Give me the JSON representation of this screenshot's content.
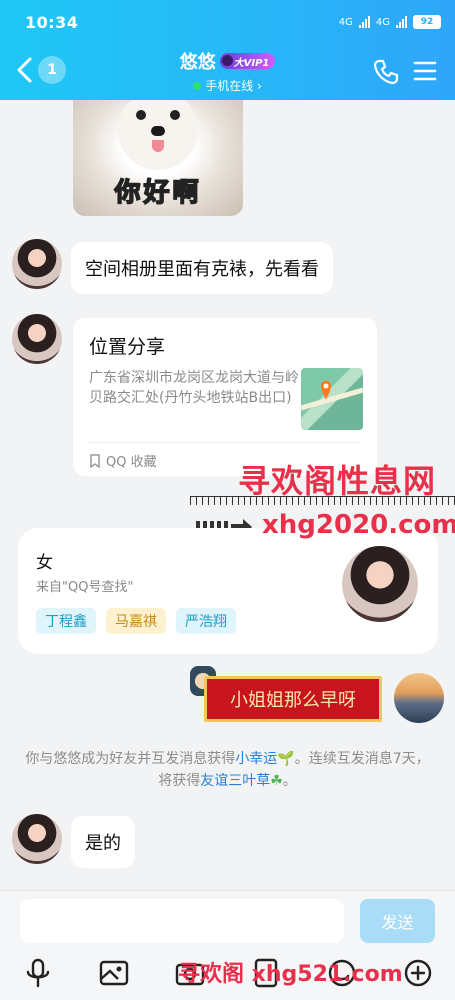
{
  "status_bar": {
    "time": "10:34",
    "net1": "4G",
    "net2": "4G",
    "battery": "92"
  },
  "header": {
    "back_count": "1",
    "title": "悠悠",
    "vip": "大VIP1",
    "status": "手机在线 ›"
  },
  "messages": {
    "sticker_text": "你好啊",
    "msg1": "空间相册里面有克裱，先看看",
    "location": {
      "title": "位置分享",
      "address": "广东省深圳市龙岗区龙岗大道与岭贝路交汇处(丹竹头地铁站B出口)",
      "footer": "QQ 收藏"
    },
    "profile": {
      "gender": "女",
      "source": "来自\"QQ号查找\"",
      "tags": [
        "丁程鑫",
        "马嘉祺",
        "严浩翔"
      ]
    },
    "self_msg": "小姐姐那么早呀",
    "system": {
      "part1": "你与悠悠成为好友并互发消息获得",
      "link1": "小幸运",
      "part2": "。连续互发消息7天，将获得",
      "link2": "友谊三叶草",
      "part3": "。"
    },
    "msg2": "是的"
  },
  "watermarks": {
    "w1": "寻欢阁性息网",
    "w2": "xhg2020.com",
    "w3": "寻欢阁 xhg521.com"
  },
  "input": {
    "placeholder": "",
    "send_label": "发送"
  },
  "colors": {
    "header_start": "#1fc8f5",
    "header_end": "#2fa6f9",
    "watermark": "#e8304a",
    "send_disabled": "#a9dcf7"
  }
}
